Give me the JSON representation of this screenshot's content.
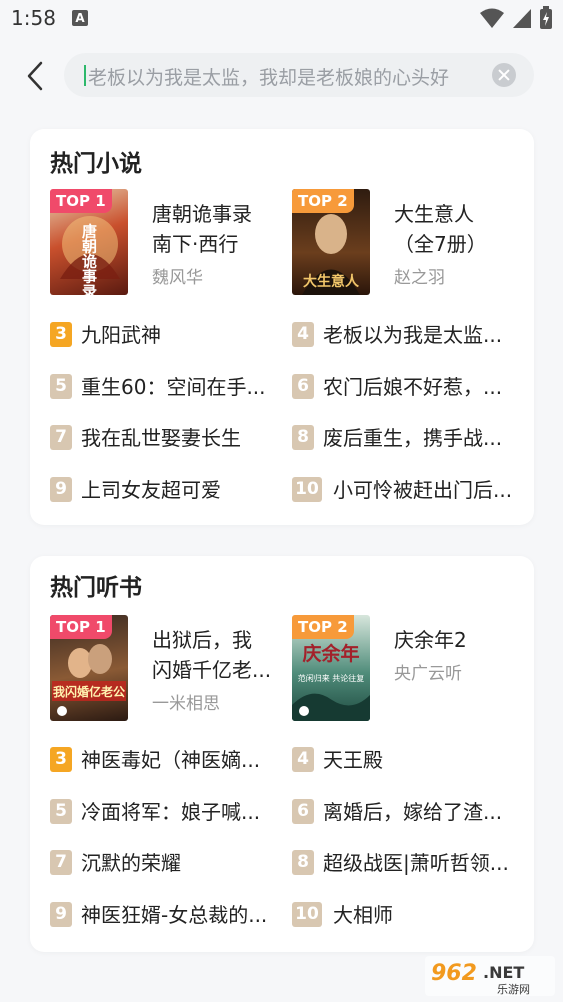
{
  "status_bar": {
    "time": "1:58",
    "notif_letter": "A"
  },
  "search": {
    "query": "老板以为我是太监，我却是老板娘的心头好"
  },
  "sections": [
    {
      "title": "热门小说",
      "top": [
        {
          "badge": "TOP 1",
          "title_line1": "唐朝诡事录",
          "title_line2": "南下·西行",
          "author": "魏风华"
        },
        {
          "badge": "TOP 2",
          "title_line1": "大生意人",
          "title_line2": "（全7册）",
          "author": "赵之羽"
        }
      ],
      "list": [
        {
          "num": "3",
          "name": "九阳武神"
        },
        {
          "num": "4",
          "name": "老板以为我是太监..."
        },
        {
          "num": "5",
          "name": "重生60：空间在手..."
        },
        {
          "num": "6",
          "name": "农门后娘不好惹，..."
        },
        {
          "num": "7",
          "name": "我在乱世娶妻长生"
        },
        {
          "num": "8",
          "name": "废后重生，携手战..."
        },
        {
          "num": "9",
          "name": "上司女友超可爱"
        },
        {
          "num": "10",
          "name": "小可怜被赶出门后..."
        }
      ]
    },
    {
      "title": "热门听书",
      "top": [
        {
          "badge": "TOP 1",
          "title_line1": "出狱后，我",
          "title_line2": "闪婚千亿老...",
          "author": "一米相思"
        },
        {
          "badge": "TOP 2",
          "title_line1": "庆余年2",
          "title_line2": "",
          "author": "央广云听"
        }
      ],
      "list": [
        {
          "num": "3",
          "name": "神医毒妃（神医嫡..."
        },
        {
          "num": "4",
          "name": "天王殿"
        },
        {
          "num": "5",
          "name": "冷面将军：娘子喊..."
        },
        {
          "num": "6",
          "name": "离婚后，嫁给了渣..."
        },
        {
          "num": "7",
          "name": "沉默的荣耀"
        },
        {
          "num": "8",
          "name": "超级战医|萧听哲领..."
        },
        {
          "num": "9",
          "name": "神医狂婿-女总裁的..."
        },
        {
          "num": "10",
          "name": "大相师"
        }
      ]
    }
  ],
  "covers": {
    "c1_text": "唐朝诡事录",
    "c2_text": "大生意人",
    "c3_text": "我闪婚亿老公",
    "c4_text": "庆余年",
    "c4_sub": "范闲归来 共论往复"
  },
  "watermark": {
    "number": "962",
    "suffix": ".NET",
    "sub": "乐游网"
  },
  "colors": {
    "top1": "#f04a6a",
    "top2": "#f79a3a",
    "num_top3": "#f5a623",
    "num_other": "#d8c7b1"
  }
}
